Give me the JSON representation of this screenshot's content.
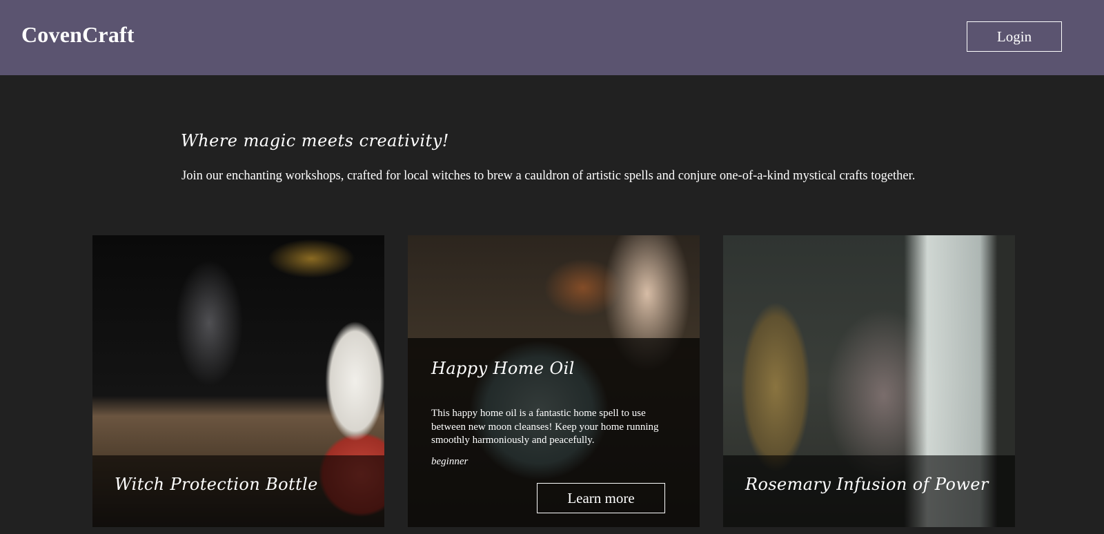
{
  "header": {
    "brand": "CovenCraft",
    "login_label": "Login"
  },
  "hero": {
    "title": "Where magic meets creativity!",
    "text": "Join our enchanting workshops, crafted for local witches to brew a cauldron of artistic spells and conjure one-of-a-kind mystical crafts together."
  },
  "cards": [
    {
      "title": "Witch Protection Bottle",
      "image": "candle-smoke-pumpkin-photo"
    },
    {
      "title": "Happy Home Oil",
      "description": "This happy home oil is a fantastic home spell to use between new moon cleanses! Keep your home running smoothly harmoniously and peacefully.",
      "level": "beginner",
      "button_label": "Learn more",
      "image": "mortar-oil-bottle-photo"
    },
    {
      "title": "Rosemary Infusion of Power",
      "image": "hanging-dried-herbs-photo"
    }
  ],
  "colors": {
    "header_bg": "#5b5470",
    "page_bg": "#212121",
    "text": "#ffffff"
  }
}
